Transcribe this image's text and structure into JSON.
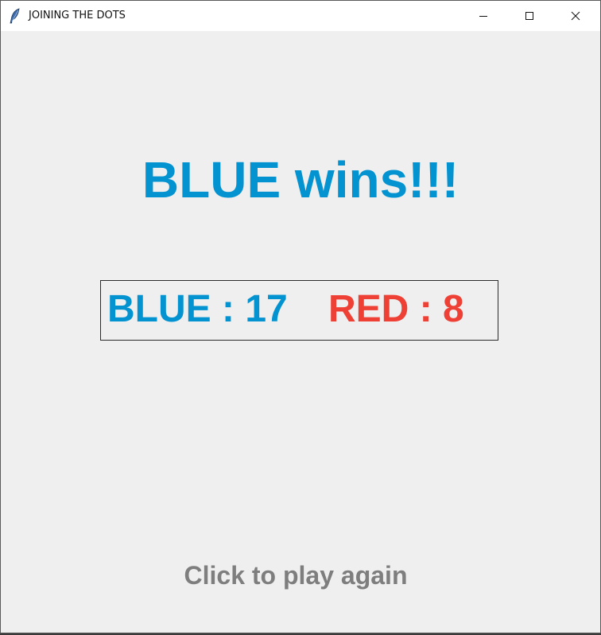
{
  "window": {
    "title": "JOINING THE DOTS",
    "icon": "feather-icon",
    "controls": [
      "minimize-icon",
      "maximize-icon",
      "close-icon"
    ]
  },
  "game_over": {
    "winner_text": "BLUE wins!!!",
    "winner_color": "#0493d1",
    "scores": {
      "blue_text": "BLUE : 17",
      "red_text": "RED : 8",
      "blue_value": 17,
      "red_value": 8,
      "blue_color": "#0493d1",
      "red_color": "#ee4035"
    },
    "play_again_text": "Click to play again",
    "play_again_color": "#7e7e7e"
  },
  "colors": {
    "background": "#efefef",
    "titlebar": "#ffffff"
  }
}
